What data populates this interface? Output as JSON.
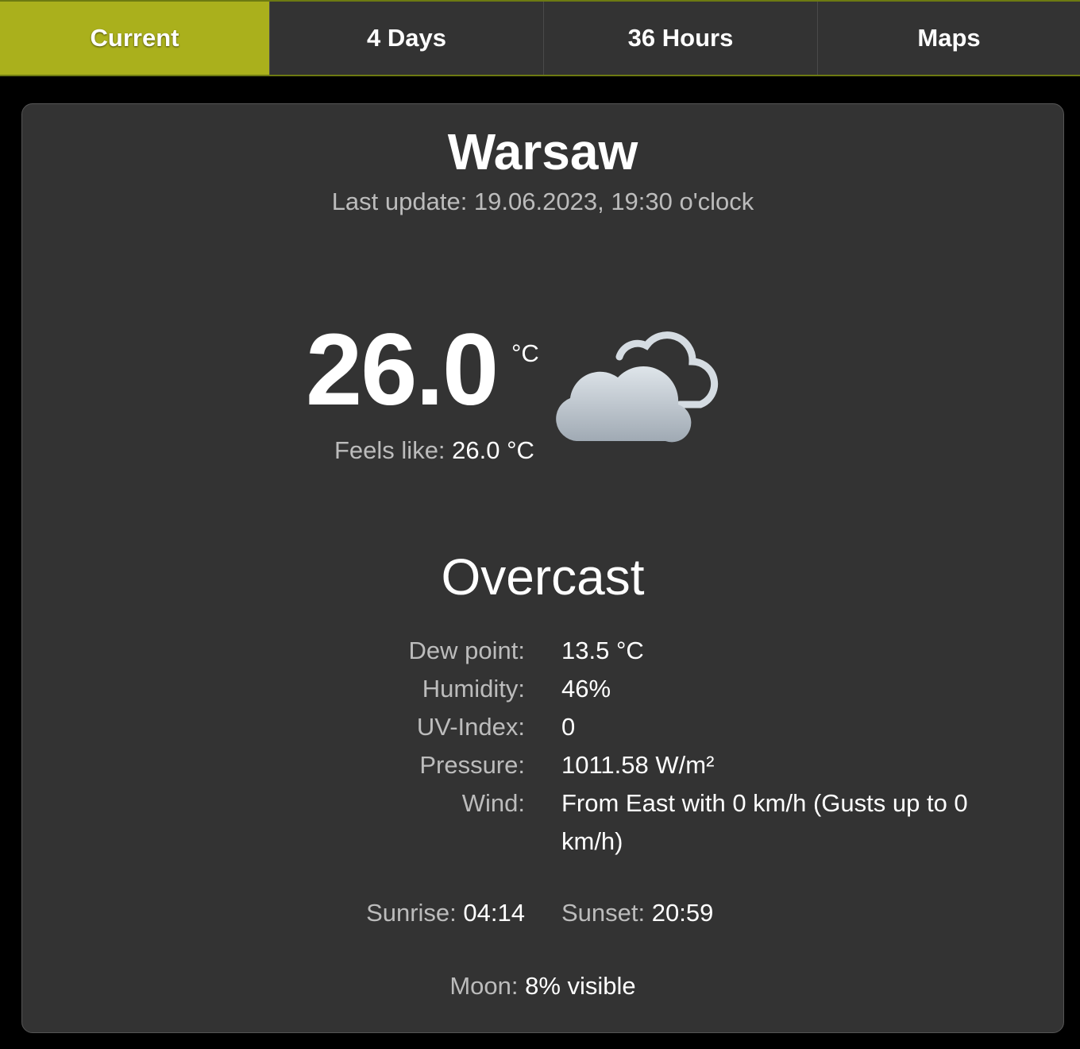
{
  "tabs": [
    {
      "label": "Current",
      "active": true
    },
    {
      "label": "4 Days",
      "active": false
    },
    {
      "label": "36 Hours",
      "active": false
    },
    {
      "label": "Maps",
      "active": false
    }
  ],
  "colors": {
    "accent": "#aab01c",
    "panel": "#333333",
    "background": "#000000",
    "muted_text": "#bcbcbc"
  },
  "current": {
    "city": "Warsaw",
    "last_update": "Last update: 19.06.2023, 19:30 o'clock",
    "temperature": "26.0",
    "temperature_unit": "°C",
    "feels_like_label": "Feels like:",
    "feels_like_value": "26.0 °C",
    "icon": "overcast-cloud-icon",
    "condition": "Overcast",
    "details": [
      {
        "label": "Dew point:",
        "value": "13.5 °C"
      },
      {
        "label": "Humidity:",
        "value": "46%"
      },
      {
        "label": "UV-Index:",
        "value": "0"
      },
      {
        "label": "Pressure:",
        "value": "1011.58 W/m²"
      },
      {
        "label": "Wind:",
        "value": "From East with 0 km/h (Gusts up to 0 km/h)"
      }
    ],
    "sunrise_label": "Sunrise:",
    "sunrise_value": "04:14",
    "sunset_label": "Sunset:",
    "sunset_value": "20:59",
    "moon_label": "Moon:",
    "moon_value": "8% visible"
  }
}
